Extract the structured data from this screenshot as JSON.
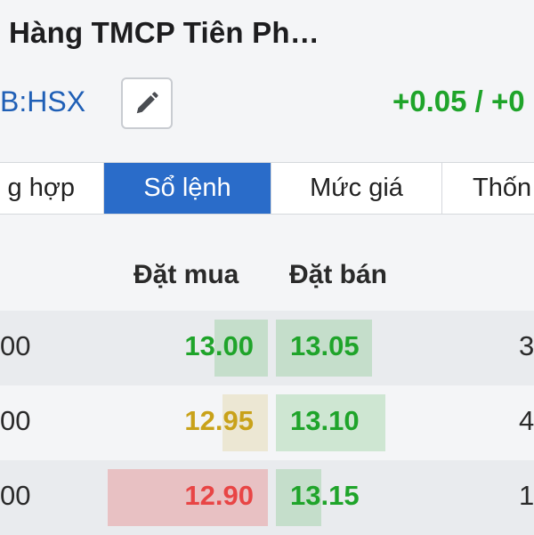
{
  "header": {
    "title": "Hàng TMCP Tiên Ph…",
    "ticker": "B:HSX",
    "change": "+0.05 / +0"
  },
  "tabs": [
    {
      "label": "g hợp",
      "active": false
    },
    {
      "label": "Sổ lệnh",
      "active": true
    },
    {
      "label": "Mức giá",
      "active": false
    },
    {
      "label": "Thốn",
      "active": false
    }
  ],
  "columns": {
    "bid": "Đặt mua",
    "ask": "Đặt bán"
  },
  "colors": {
    "accent": "#2a6cc9",
    "up": "#1fa42a",
    "reference": "#c9a21a",
    "down": "#e84545"
  },
  "orderbook": [
    {
      "left": "00",
      "bid": "13.00",
      "bid_color": "up",
      "bid_share": 0.2,
      "ask": "13.05",
      "ask_color": "up",
      "ask_share": 0.36,
      "right": "3"
    },
    {
      "left": "00",
      "bid": "12.95",
      "bid_color": "reference",
      "bid_share": 0.17,
      "ask": "13.10",
      "ask_color": "up",
      "ask_share": 0.41,
      "right": "4"
    },
    {
      "left": "00",
      "bid": "12.90",
      "bid_color": "down",
      "bid_share": 0.6,
      "ask": "13.15",
      "ask_color": "up",
      "ask_share": 0.17,
      "right": "1"
    }
  ]
}
